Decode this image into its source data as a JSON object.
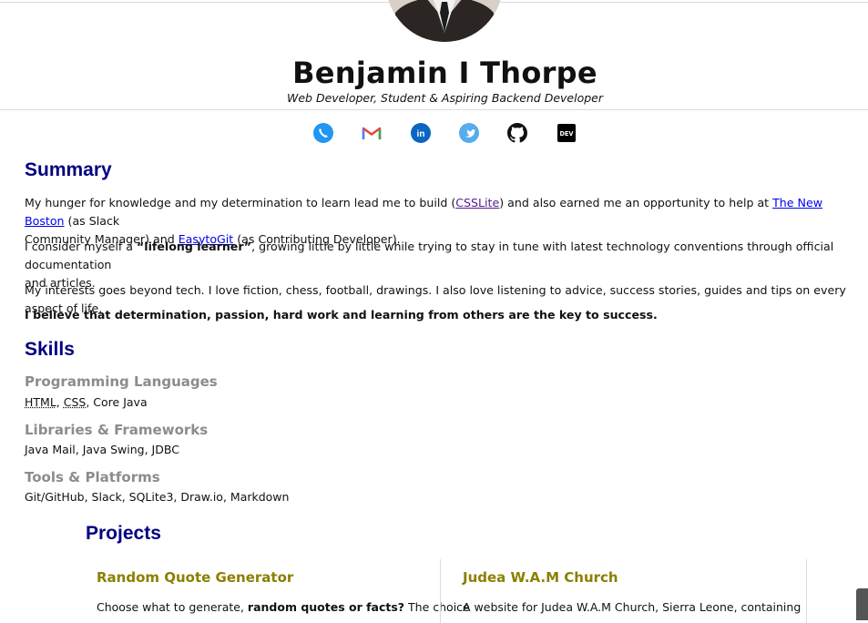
{
  "header": {
    "name": "Benjamin I Thorpe",
    "subtitle": "Web Developer, Student & Aspiring Backend Developer"
  },
  "social": [
    {
      "icon": "phone-icon",
      "color": "#1e88e5"
    },
    {
      "icon": "gmail-icon",
      "color": "#ea4335"
    },
    {
      "icon": "linkedin-icon",
      "color": "#0a66c2"
    },
    {
      "icon": "twitter-icon",
      "color": "#55acee"
    },
    {
      "icon": "github-icon",
      "color": "#111111"
    },
    {
      "icon": "dev-icon",
      "color": "#000000",
      "label": "DEV"
    }
  ],
  "summary": {
    "heading": "Summary",
    "p1": {
      "a": "My hunger for knowledge and my determination to learn lead me to build (",
      "link1": "CSSLite",
      "b": ") and also earned me an opportunity to help at ",
      "link2": "The New Boston",
      "c": " (as Slack",
      "d": "Community Manager) and ",
      "link3": "EasytoGit",
      "e": " (as Contributing Developer)."
    },
    "p2": {
      "a": "I consider myself a ",
      "bold": "“lifelong learner”",
      "b": ", growing little by little while trying to stay in tune with latest technology conventions through official documentation",
      "c": "and articles."
    },
    "p3": "My interests goes beyond tech. I love fiction, chess, football, drawings. I also love listening to advice, success stories, guides and tips on every aspect of life.",
    "p4": "I believe that determination, passion, hard work and learning from others are the key to success."
  },
  "skills": {
    "heading": "Skills",
    "groups": [
      {
        "title": "Programming Languages",
        "abbr1": "HTML",
        "sep1": ", ",
        "abbr2": "CSS",
        "rest": ", Core Java"
      },
      {
        "title": "Libraries & Frameworks",
        "values": "Java Mail, Java Swing, JDBC"
      },
      {
        "title": "Tools & Platforms",
        "values": "Git/GitHub, Slack, SQLite3, Draw.io, Markdown"
      }
    ]
  },
  "projects": {
    "heading": "Projects",
    "items": [
      {
        "title": "Random Quote Generator",
        "desc_a": "Choose what to generate, ",
        "desc_bold": "random quotes or facts?",
        "desc_b": " The choice"
      },
      {
        "title": "Judea W.A.M Church",
        "desc_a": "A website for Judea W.A.M Church, Sierra Leone, containing"
      }
    ]
  }
}
